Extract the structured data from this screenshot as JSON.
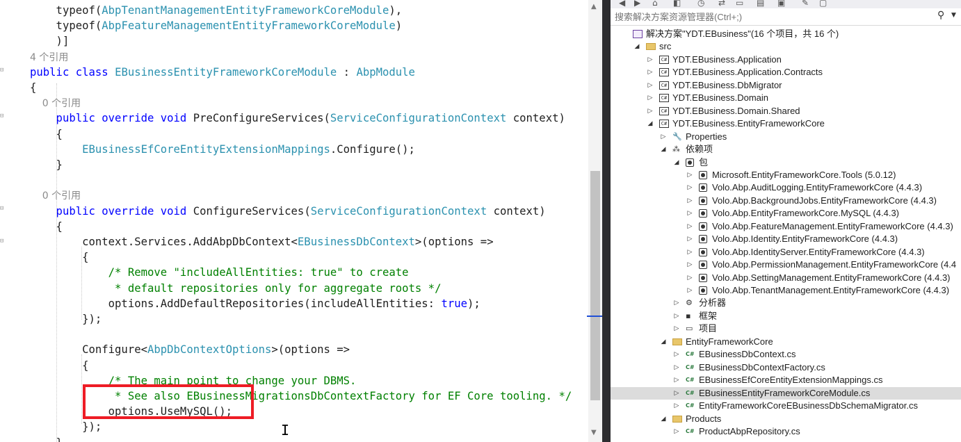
{
  "editor": {
    "lines": [
      [
        [
          "    typeof(",
          "pl"
        ],
        [
          "AbpTenantManagementEntityFrameworkCoreModule",
          "ty"
        ],
        [
          "),",
          "pl"
        ]
      ],
      [
        [
          "    typeof(",
          "pl"
        ],
        [
          "AbpFeatureManagementEntityFrameworkCoreModule",
          "ty"
        ],
        [
          ")",
          "pl"
        ]
      ],
      [
        [
          "    )]",
          "pl"
        ]
      ],
      [
        [
          "4 个引用",
          "cl"
        ]
      ],
      [
        [
          "public class ",
          "kw"
        ],
        [
          "EBusinessEntityFrameworkCoreModule",
          "ty"
        ],
        [
          " : ",
          "pl"
        ],
        [
          "AbpModule",
          "ty"
        ]
      ],
      [
        [
          "{",
          "pl"
        ]
      ],
      [
        [
          "    0 个引用",
          "cl"
        ]
      ],
      [
        [
          "    public override void ",
          "kw"
        ],
        [
          "PreConfigureServices(",
          "pl"
        ],
        [
          "ServiceConfigurationContext",
          "ty"
        ],
        [
          " context)",
          "pl"
        ]
      ],
      [
        [
          "    {",
          "pl"
        ]
      ],
      [
        [
          "        ",
          "pl"
        ],
        [
          "EBusinessEfCoreEntityExtensionMappings",
          "ty"
        ],
        [
          ".Configure();",
          "pl"
        ]
      ],
      [
        [
          "    }",
          "pl"
        ]
      ],
      [
        [
          "",
          "pl"
        ]
      ],
      [
        [
          "    0 个引用",
          "cl"
        ]
      ],
      [
        [
          "    public override void ",
          "kw"
        ],
        [
          "ConfigureServices(",
          "pl"
        ],
        [
          "ServiceConfigurationContext",
          "ty"
        ],
        [
          " context)",
          "pl"
        ]
      ],
      [
        [
          "    {",
          "pl"
        ]
      ],
      [
        [
          "        context.Services.AddAbpDbContext<",
          "pl"
        ],
        [
          "EBusinessDbContext",
          "ty"
        ],
        [
          ">(options =>",
          "pl"
        ]
      ],
      [
        [
          "        {",
          "pl"
        ]
      ],
      [
        [
          "            /* Remove \"includeAllEntities: true\" to create",
          "cm"
        ]
      ],
      [
        [
          "             * default repositories only for aggregate roots */",
          "cm"
        ]
      ],
      [
        [
          "            options.AddDefaultRepositories(includeAllEntities: ",
          "pl"
        ],
        [
          "true",
          "kw"
        ],
        [
          ");",
          "pl"
        ]
      ],
      [
        [
          "        });",
          "pl"
        ]
      ],
      [
        [
          "",
          "pl"
        ]
      ],
      [
        [
          "        Configure<",
          "pl"
        ],
        [
          "AbpDbContextOptions",
          "ty"
        ],
        [
          ">(options =>",
          "pl"
        ]
      ],
      [
        [
          "        {",
          "pl"
        ]
      ],
      [
        [
          "            /* The main point to change your DBMS.",
          "cm"
        ]
      ],
      [
        [
          "             * See also EBusinessMigrationsDbContextFactory for EF Core tooling. */",
          "cm"
        ]
      ],
      [
        [
          "            options.UseMySQL();",
          "pl"
        ]
      ],
      [
        [
          "        });",
          "pl"
        ]
      ],
      [
        [
          "    }",
          "pl"
        ]
      ]
    ]
  },
  "explorer": {
    "search_placeholder": "搜索解决方案资源管理器(Ctrl+;)",
    "items": [
      {
        "label": "解决方案\"YDT.EBusiness\"(16 个项目，共 16 个)",
        "icon": "solution-icon",
        "arrow": "",
        "indent": 0
      },
      {
        "label": "src",
        "icon": "folder-icon",
        "arrow": "expanded",
        "indent": 1
      },
      {
        "label": "YDT.EBusiness.Application",
        "icon": "csharp-project-icon",
        "arrow": "collapsed",
        "indent": 2
      },
      {
        "label": "YDT.EBusiness.Application.Contracts",
        "icon": "csharp-project-icon",
        "arrow": "collapsed",
        "indent": 2
      },
      {
        "label": "YDT.EBusiness.DbMigrator",
        "icon": "csharp-project-icon",
        "arrow": "collapsed",
        "indent": 2
      },
      {
        "label": "YDT.EBusiness.Domain",
        "icon": "csharp-project-icon",
        "arrow": "collapsed",
        "indent": 2
      },
      {
        "label": "YDT.EBusiness.Domain.Shared",
        "icon": "csharp-project-icon",
        "arrow": "collapsed",
        "indent": 2
      },
      {
        "label": "YDT.EBusiness.EntityFrameworkCore",
        "icon": "csharp-project-icon",
        "arrow": "expanded",
        "indent": 2
      },
      {
        "label": "Properties",
        "icon": "properties-icon",
        "arrow": "collapsed",
        "indent": 3
      },
      {
        "label": "依赖项",
        "icon": "dependencies-icon",
        "arrow": "expanded",
        "indent": 3
      },
      {
        "label": "包",
        "icon": "package-icon",
        "arrow": "expanded",
        "indent": 4
      },
      {
        "label": "Microsoft.EntityFrameworkCore.Tools (5.0.12)",
        "icon": "package-icon",
        "arrow": "collapsed",
        "indent": 5
      },
      {
        "label": "Volo.Abp.AuditLogging.EntityFrameworkCore (4.4.3)",
        "icon": "package-icon",
        "arrow": "collapsed",
        "indent": 5
      },
      {
        "label": "Volo.Abp.BackgroundJobs.EntityFrameworkCore (4.4.3)",
        "icon": "package-icon",
        "arrow": "collapsed",
        "indent": 5
      },
      {
        "label": "Volo.Abp.EntityFrameworkCore.MySQL (4.4.3)",
        "icon": "package-icon",
        "arrow": "collapsed",
        "indent": 5
      },
      {
        "label": "Volo.Abp.FeatureManagement.EntityFrameworkCore (4.4.3)",
        "icon": "package-icon",
        "arrow": "collapsed",
        "indent": 5
      },
      {
        "label": "Volo.Abp.Identity.EntityFrameworkCore (4.4.3)",
        "icon": "package-icon",
        "arrow": "collapsed",
        "indent": 5
      },
      {
        "label": "Volo.Abp.IdentityServer.EntityFrameworkCore (4.4.3)",
        "icon": "package-icon",
        "arrow": "collapsed",
        "indent": 5
      },
      {
        "label": "Volo.Abp.PermissionManagement.EntityFrameworkCore (4.4",
        "icon": "package-icon",
        "arrow": "collapsed",
        "indent": 5
      },
      {
        "label": "Volo.Abp.SettingManagement.EntityFrameworkCore (4.4.3)",
        "icon": "package-icon",
        "arrow": "collapsed",
        "indent": 5
      },
      {
        "label": "Volo.Abp.TenantManagement.EntityFrameworkCore (4.4.3)",
        "icon": "package-icon",
        "arrow": "collapsed",
        "indent": 5
      },
      {
        "label": "分析器",
        "icon": "analyzer-icon",
        "arrow": "collapsed",
        "indent": 4
      },
      {
        "label": "框架",
        "icon": "framework-icon",
        "arrow": "collapsed",
        "indent": 4
      },
      {
        "label": "项目",
        "icon": "project-ref-icon",
        "arrow": "collapsed",
        "indent": 4
      },
      {
        "label": "EntityFrameworkCore",
        "icon": "folder-icon",
        "arrow": "expanded",
        "indent": 3
      },
      {
        "label": "EBusinessDbContext.cs",
        "icon": "csharp-file-icon",
        "arrow": "collapsed",
        "indent": 4
      },
      {
        "label": "EBusinessDbContextFactory.cs",
        "icon": "csharp-file-icon",
        "arrow": "collapsed",
        "indent": 4
      },
      {
        "label": "EBusinessEfCoreEntityExtensionMappings.cs",
        "icon": "csharp-file-icon",
        "arrow": "collapsed",
        "indent": 4
      },
      {
        "label": "EBusinessEntityFrameworkCoreModule.cs",
        "icon": "csharp-file-icon",
        "arrow": "collapsed",
        "indent": 4,
        "selected": true
      },
      {
        "label": "EntityFrameworkCoreEBusinessDbSchemaMigrator.cs",
        "icon": "csharp-file-icon",
        "arrow": "collapsed",
        "indent": 4
      },
      {
        "label": "Products",
        "icon": "folder-icon",
        "arrow": "expanded",
        "indent": 3
      },
      {
        "label": "ProductAbpRepository.cs",
        "icon": "csharp-file-icon",
        "arrow": "collapsed",
        "indent": 4
      }
    ]
  }
}
